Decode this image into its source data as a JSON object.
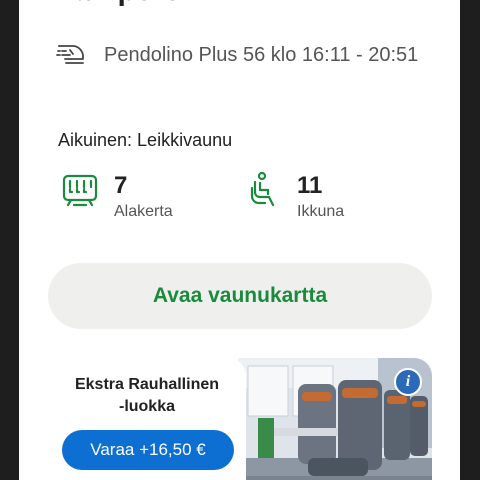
{
  "trip": {
    "destination": "Tampere",
    "train": "Pendolino Plus 56 klo 16:11 - 20:51"
  },
  "passenger": {
    "type_label": "Aikuinen: Leikkivaunu"
  },
  "seat": {
    "car_number": "7",
    "car_label": "Alakerta",
    "seat_number": "11",
    "seat_label": "Ikkuna"
  },
  "actions": {
    "open_map_label": "Avaa vaunukartta"
  },
  "promo": {
    "title_line1": "Ekstra Rauhallinen",
    "title_line2": "-luokka",
    "book_label": "Varaa +16,50 €",
    "info_icon": "i"
  },
  "colors": {
    "accent_green": "#1a8a3d",
    "button_blue": "#0d6fd1"
  }
}
